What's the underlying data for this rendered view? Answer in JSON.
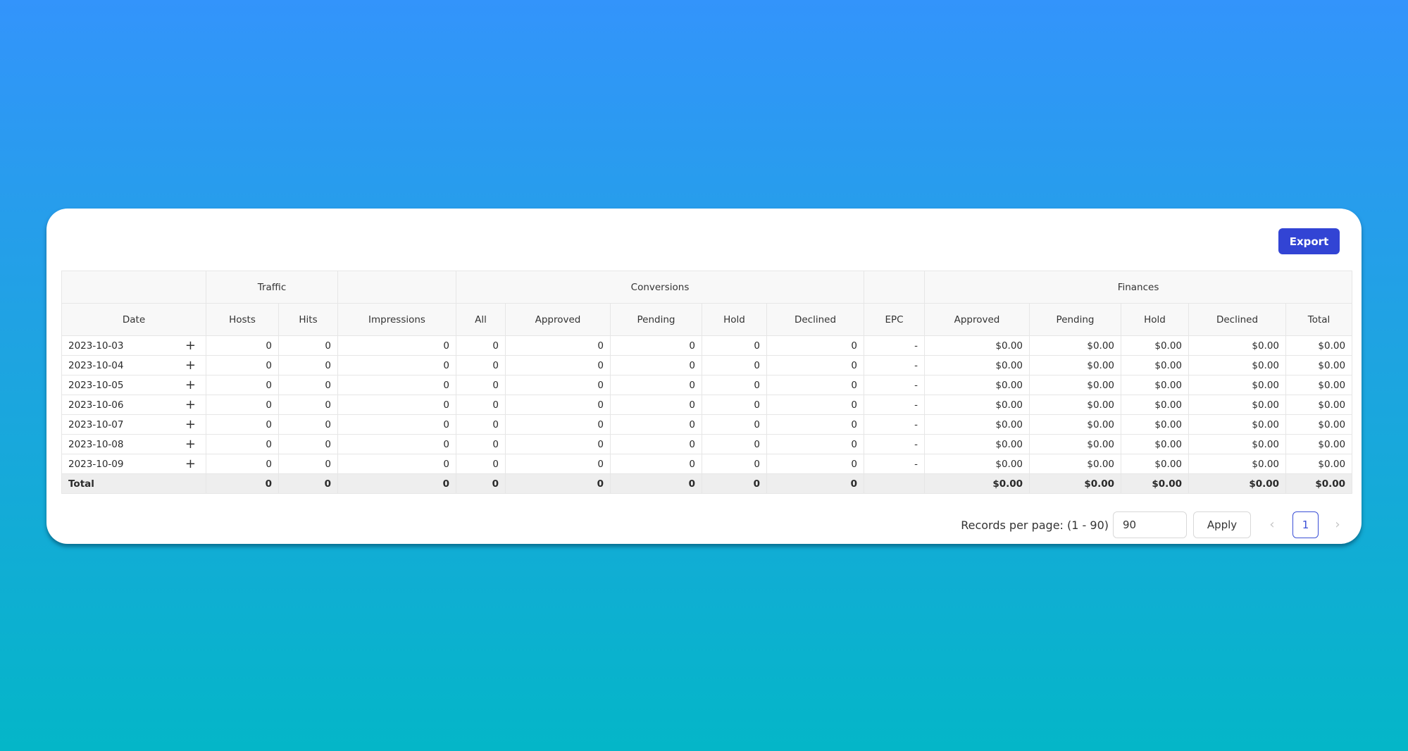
{
  "toolbar": {
    "export_label": "Export"
  },
  "table": {
    "groups": {
      "traffic": "Traffic",
      "conversions": "Conversions",
      "finances": "Finances"
    },
    "columns": [
      "Date",
      "Hosts",
      "Hits",
      "Impressions",
      "All",
      "Approved",
      "Pending",
      "Hold",
      "Declined",
      "EPC",
      "Approved",
      "Pending",
      "Hold",
      "Declined",
      "Total"
    ],
    "expand_symbol": "+",
    "rows": [
      {
        "date": "2023-10-03",
        "cells": [
          "0",
          "0",
          "0",
          "0",
          "0",
          "0",
          "0",
          "0",
          "-",
          "$0.00",
          "$0.00",
          "$0.00",
          "$0.00",
          "$0.00"
        ]
      },
      {
        "date": "2023-10-04",
        "cells": [
          "0",
          "0",
          "0",
          "0",
          "0",
          "0",
          "0",
          "0",
          "-",
          "$0.00",
          "$0.00",
          "$0.00",
          "$0.00",
          "$0.00"
        ]
      },
      {
        "date": "2023-10-05",
        "cells": [
          "0",
          "0",
          "0",
          "0",
          "0",
          "0",
          "0",
          "0",
          "-",
          "$0.00",
          "$0.00",
          "$0.00",
          "$0.00",
          "$0.00"
        ]
      },
      {
        "date": "2023-10-06",
        "cells": [
          "0",
          "0",
          "0",
          "0",
          "0",
          "0",
          "0",
          "0",
          "-",
          "$0.00",
          "$0.00",
          "$0.00",
          "$0.00",
          "$0.00"
        ]
      },
      {
        "date": "2023-10-07",
        "cells": [
          "0",
          "0",
          "0",
          "0",
          "0",
          "0",
          "0",
          "0",
          "-",
          "$0.00",
          "$0.00",
          "$0.00",
          "$0.00",
          "$0.00"
        ]
      },
      {
        "date": "2023-10-08",
        "cells": [
          "0",
          "0",
          "0",
          "0",
          "0",
          "0",
          "0",
          "0",
          "-",
          "$0.00",
          "$0.00",
          "$0.00",
          "$0.00",
          "$0.00"
        ]
      },
      {
        "date": "2023-10-09",
        "cells": [
          "0",
          "0",
          "0",
          "0",
          "0",
          "0",
          "0",
          "0",
          "-",
          "$0.00",
          "$0.00",
          "$0.00",
          "$0.00",
          "$0.00"
        ]
      }
    ],
    "total": {
      "label": "Total",
      "cells": [
        "0",
        "0",
        "0",
        "0",
        "0",
        "0",
        "0",
        "0",
        "",
        "$0.00",
        "$0.00",
        "$0.00",
        "$0.00",
        "$0.00"
      ]
    }
  },
  "pagination": {
    "records_label": "Records per page: (1 - 90)",
    "records_value": "90",
    "apply_label": "Apply",
    "prev_symbol": "‹",
    "next_symbol": "›",
    "current_page": "1"
  }
}
